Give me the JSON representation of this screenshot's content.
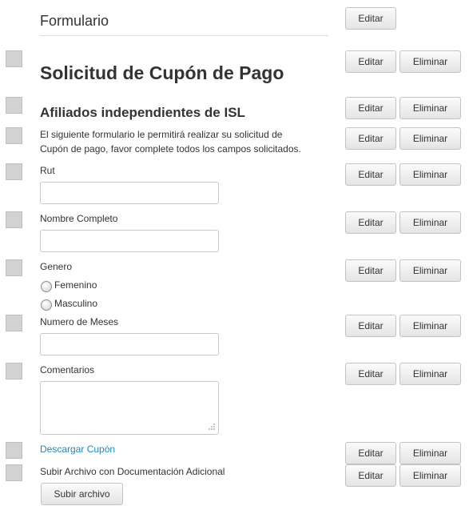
{
  "header": {
    "title": "Formulario",
    "edit_label": "Editar"
  },
  "actions": {
    "edit": "Editar",
    "delete": "Eliminar"
  },
  "form": {
    "title": "Solicitud de Cupón de Pago",
    "subtitle": "Afiliados independientes de ISL",
    "intro_line1": "El siguiente formulario le permitirá realizar su solicitud de",
    "intro_line2": "Cupón de pago, favor complete todos los campos solicitados.",
    "rut_label": "Rut",
    "name_label": "Nombre Completo",
    "gender_label": "Genero",
    "gender_options": [
      "Femenino",
      "Masculino"
    ],
    "months_label": "Numero de Meses",
    "comments_label": "Comentarios",
    "download_link": "Descargar Cupón",
    "upload_label": "Subir Archivo con Documentación Adicional",
    "upload_button": "Subir archivo"
  },
  "colors": {
    "link": "#1e88c7",
    "handle": "#d2d2d2",
    "divider": "#dddddd"
  }
}
